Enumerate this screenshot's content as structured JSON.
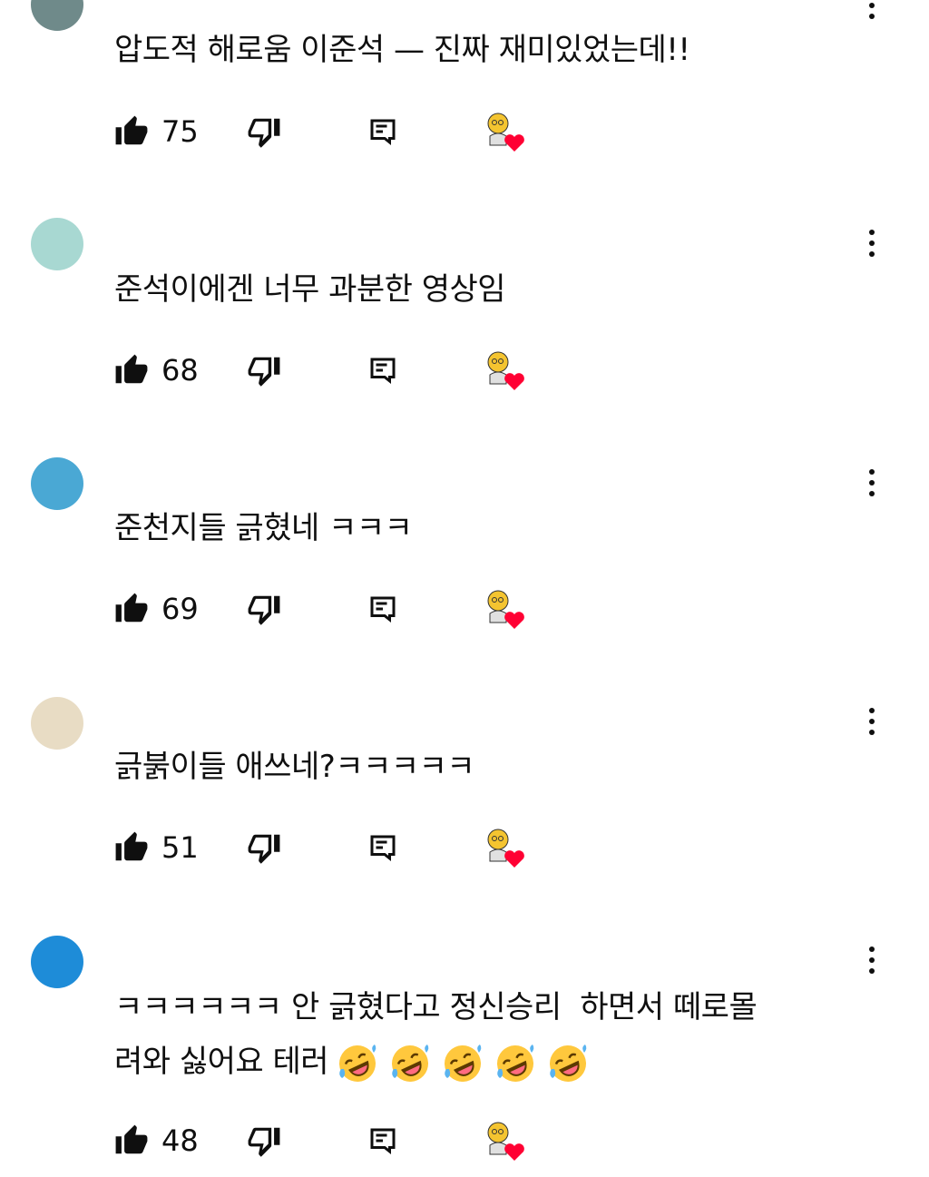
{
  "comments": [
    {
      "text": "압도적 해로움 이준석 — 진짜 재미있었는데!!",
      "likes": "75",
      "avatar_color": "#6f8a8a"
    },
    {
      "text": "준석이에겐 너무 과분한 영상임",
      "likes": "68",
      "avatar_color": "#a8d8d2"
    },
    {
      "text": "준천지들 긁혔네 ㅋㅋㅋ",
      "likes": "69",
      "avatar_color": "#4aa8d4"
    },
    {
      "text": "긁붉이들 애쓰네?ㅋㅋㅋㅋㅋ",
      "likes": "51",
      "avatar_color": "#e8dcc4"
    },
    {
      "text": "ㅋㅋㅋㅋㅋㅋ 안 긁혔다고 정신승리  하면서 떼로몰\n려와 싫어요 테러",
      "likes": "48",
      "avatar_color": "#1e8cd8",
      "emojis": 5
    }
  ],
  "icons": {
    "like": "thumbs-up-filled-icon",
    "dislike": "thumbs-down-outline-icon",
    "reply": "reply-comment-icon",
    "creator_heart": "creator-heart-badge",
    "menu": "more-vertical-icon",
    "emoji": "rolling-on-floor-laughing-emoji"
  },
  "colors": {
    "heart": "#ff0033",
    "text": "#0f0f0f"
  }
}
